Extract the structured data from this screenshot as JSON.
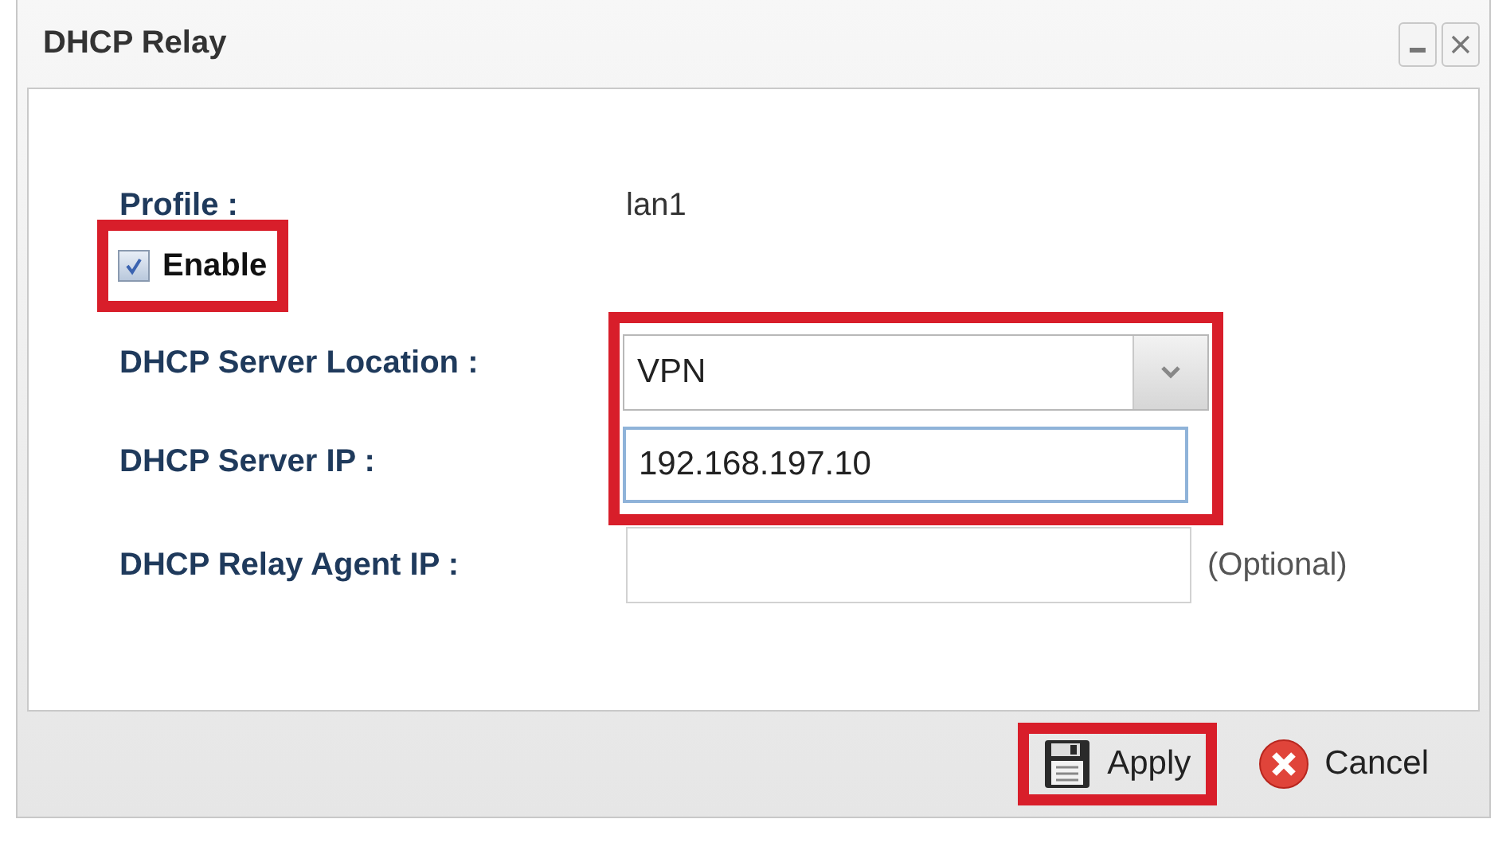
{
  "window": {
    "title": "DHCP Relay"
  },
  "profile": {
    "label": "Profile :",
    "value": "lan1"
  },
  "enable": {
    "label": "Enable",
    "checked": true,
    "highlighted": true
  },
  "fields": [
    {
      "kind": "select",
      "label": "DHCP Server Location :",
      "value": "VPN",
      "highlighted": true
    },
    {
      "kind": "text",
      "label": "DHCP Server IP :",
      "value": "192.168.197.10",
      "focused": true,
      "highlighted": true
    },
    {
      "kind": "text",
      "label": "DHCP Relay Agent IP :",
      "note": "(Optional)",
      "focused": false,
      "highlighted": false
    }
  ],
  "buttons": [
    {
      "kind": "apply",
      "label": "Apply",
      "highlighted": true
    },
    {
      "kind": "cancel",
      "label": "Cancel",
      "highlighted": false
    }
  ]
}
